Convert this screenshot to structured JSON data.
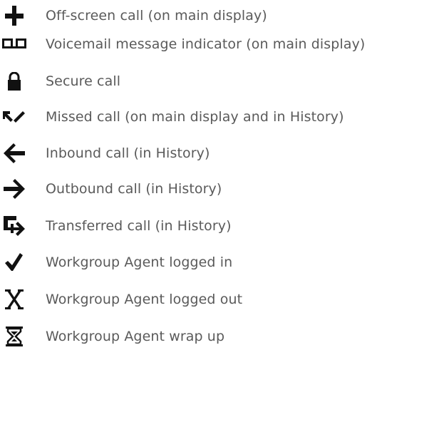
{
  "legend": {
    "items": [
      {
        "icon": "off-screen-call-icon",
        "label": "Off-screen call (on main display)"
      },
      {
        "icon": "voicemail-icon",
        "label": "Voicemail message indicator (on main display)"
      },
      {
        "icon": "lock-icon",
        "label": "Secure call"
      },
      {
        "icon": "missed-call-icon",
        "label": "Missed call (on main display and in History)"
      },
      {
        "icon": "inbound-arrow-icon",
        "label": "Inbound call (in History)"
      },
      {
        "icon": "outbound-arrow-icon",
        "label": "Outbound call (in History)"
      },
      {
        "icon": "transfer-icon",
        "label": "Transferred call (in History)"
      },
      {
        "icon": "checkmark-icon",
        "label": "Workgroup Agent logged in"
      },
      {
        "icon": "x-icon",
        "label": "Workgroup Agent logged out"
      },
      {
        "icon": "hourglass-icon",
        "label": "Workgroup Agent wrap up"
      }
    ]
  },
  "colors": {
    "icon": "#111111",
    "text": "#5a5a5a",
    "background": "#ffffff"
  }
}
